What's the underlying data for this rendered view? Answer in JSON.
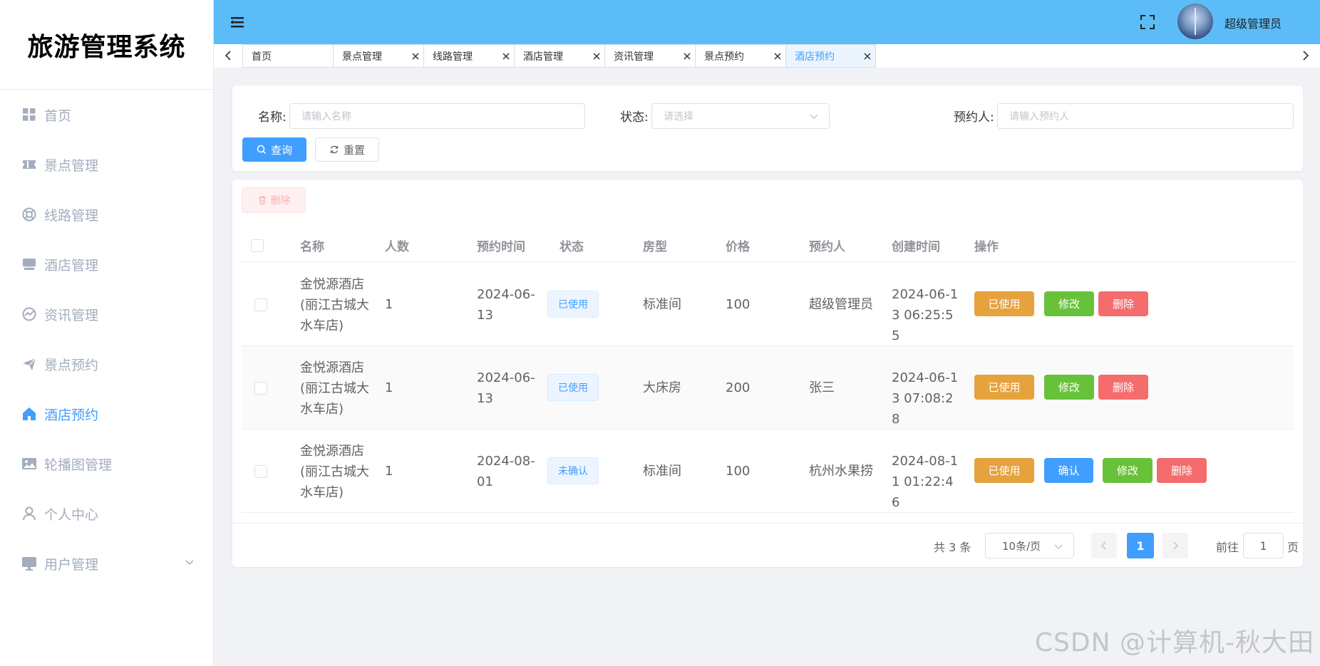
{
  "app": {
    "title": "旅游管理系统"
  },
  "sidebar": {
    "items": [
      {
        "label": "首页",
        "icon": "grid-icon"
      },
      {
        "label": "景点管理",
        "icon": "ticket-icon"
      },
      {
        "label": "线路管理",
        "icon": "lifebuoy-icon"
      },
      {
        "label": "酒店管理",
        "icon": "shop-icon"
      },
      {
        "label": "资讯管理",
        "icon": "chart-icon"
      },
      {
        "label": "景点预约",
        "icon": "send-icon"
      },
      {
        "label": "酒店预约",
        "icon": "home-icon",
        "active": true
      },
      {
        "label": "轮播图管理",
        "icon": "picture-icon"
      },
      {
        "label": "个人中心",
        "icon": "user-icon"
      },
      {
        "label": "用户管理",
        "icon": "monitor-icon",
        "has_submenu": true
      }
    ]
  },
  "header": {
    "user_name": "超级管理员"
  },
  "tabs": [
    {
      "label": "首页",
      "closable": false
    },
    {
      "label": "景点管理",
      "closable": true
    },
    {
      "label": "线路管理",
      "closable": true
    },
    {
      "label": "酒店管理",
      "closable": true
    },
    {
      "label": "资讯管理",
      "closable": true
    },
    {
      "label": "景点预约",
      "closable": true
    },
    {
      "label": "酒店预约",
      "closable": true,
      "active": true
    }
  ],
  "search": {
    "name_label": "名称:",
    "name_placeholder": "请输入名称",
    "status_label": "状态:",
    "status_placeholder": "请选择",
    "booker_label": "预约人:",
    "booker_placeholder": "请输入预约人",
    "query_label": "查询",
    "reset_label": "重置"
  },
  "toolbar": {
    "delete_label": "删除"
  },
  "table": {
    "columns": [
      "名称",
      "人数",
      "预约时间",
      "状态",
      "房型",
      "价格",
      "预约人",
      "创建时间",
      "操作"
    ],
    "rows": [
      {
        "name": "金悦源酒店(丽江古城大水车店)",
        "count": "1",
        "time": "2024-06-13",
        "status": "已使用",
        "room": "标准间",
        "price": "100",
        "booker": "超级管理员",
        "created": "2024-06-13 06:25:55",
        "actions": [
          "已使用",
          "修改",
          "删除"
        ]
      },
      {
        "name": "金悦源酒店(丽江古城大水车店)",
        "count": "1",
        "time": "2024-06-13",
        "status": "已使用",
        "room": "大床房",
        "price": "200",
        "booker": "张三",
        "created": "2024-06-13 07:08:28",
        "actions": [
          "已使用",
          "修改",
          "删除"
        ]
      },
      {
        "name": "金悦源酒店(丽江古城大水车店)",
        "count": "1",
        "time": "2024-08-01",
        "status": "未确认",
        "room": "标准间",
        "price": "100",
        "booker": "杭州水果捞",
        "created": "2024-08-11 01:22:46",
        "actions": [
          "已使用",
          "确认",
          "修改",
          "删除"
        ]
      }
    ]
  },
  "pagination": {
    "total_text": "共 3 条",
    "page_size": "10条/页",
    "current_page": "1",
    "goto_label": "前往",
    "goto_value": "1",
    "goto_suffix": "页"
  },
  "watermark": "CSDN @计算机-秋大田",
  "colors": {
    "header": "#5bbcf8",
    "primary": "#409eff",
    "warning": "#e6a23c",
    "success": "#67c23a",
    "danger": "#f56c6c"
  }
}
